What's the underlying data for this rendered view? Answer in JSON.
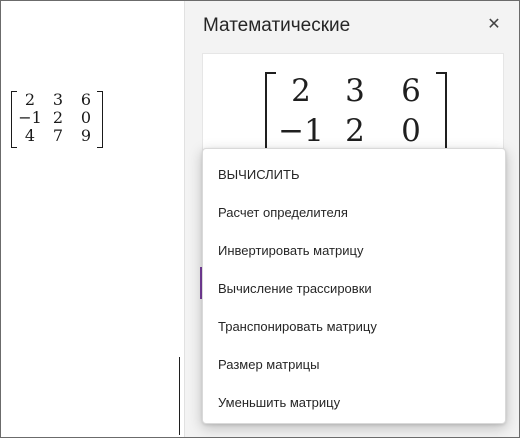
{
  "pane": {
    "title": "Математические",
    "close_icon": "close-icon",
    "close_glyph": "✕"
  },
  "matrix": {
    "rows": [
      [
        "2",
        "3",
        "6"
      ],
      [
        "−1",
        "2",
        "0"
      ],
      [
        "4",
        "7",
        "9"
      ]
    ]
  },
  "menu": {
    "items": [
      "ВЫЧИСЛИТЬ",
      "Расчет определителя",
      "Инвертировать матрицу",
      "Вычисление трассировки",
      "Транспонировать матрицу",
      "Размер матрицы",
      "Уменьшить матрицу"
    ]
  },
  "colors": {
    "accent": "#7b3fa0",
    "pane_bg": "#f3f3f3"
  }
}
